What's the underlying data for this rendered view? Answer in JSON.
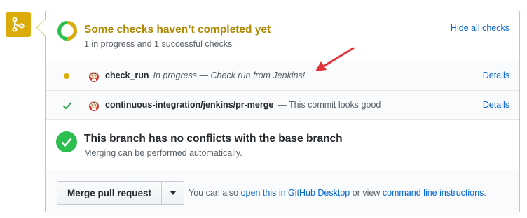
{
  "status": {
    "title": "Some checks haven’t completed yet",
    "subtitle": "1 in progress and 1 successful checks",
    "toggle_label": "Hide all checks"
  },
  "checks": [
    {
      "name": "check_run",
      "description": "In progress — Check run from Jenkins!",
      "state": "pending",
      "details_label": "Details"
    },
    {
      "name": "continuous-integration/jenkins/pr-merge",
      "description": "— This commit looks good",
      "state": "success",
      "details_label": "Details"
    }
  ],
  "conflicts": {
    "title": "This branch has no conflicts with the base branch",
    "subtitle": "Merging can be performed automatically."
  },
  "merge": {
    "button_label": "Merge pull request",
    "alt_prefix": "You can also",
    "desktop_link": "open this in GitHub Desktop",
    "alt_middle": "or view",
    "cli_link": "command line instructions",
    "alt_suffix": "."
  },
  "colors": {
    "pending": "#dbab09",
    "success": "#28a745",
    "link": "#0366d6",
    "annotation_arrow": "#e0333a"
  },
  "icons": {
    "badge": "git-merge-icon",
    "avatar": "jenkins-avatar-icon",
    "dropdown": "caret-down-icon"
  }
}
